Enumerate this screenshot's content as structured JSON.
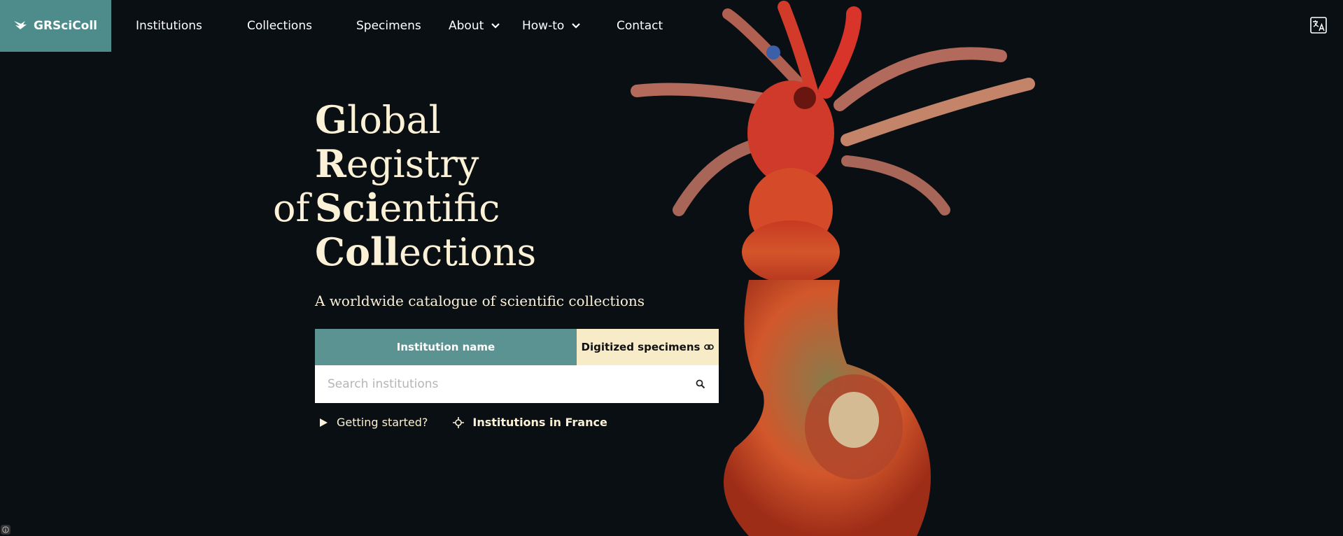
{
  "nav": {
    "brand": "GRSciColl",
    "items": [
      "Institutions",
      "Collections",
      "Specimens",
      "About",
      "How-to",
      "Contact"
    ]
  },
  "hero": {
    "title": [
      {
        "pre": "",
        "bold": "G",
        "rest": "lobal"
      },
      {
        "pre": "",
        "bold": "R",
        "rest": "egistry"
      },
      {
        "pre": "of",
        "bold": "Sci",
        "rest": "entific"
      },
      {
        "pre": "",
        "bold": "Coll",
        "rest": "ections"
      }
    ],
    "subtitle": "A worldwide catalogue of scientific collections"
  },
  "search": {
    "tab_institution": "Institution name",
    "tab_specimens": "Digitized specimens",
    "placeholder": "Search institutions"
  },
  "links": {
    "getting_started": "Getting started?",
    "country": "Institutions in France"
  },
  "colors": {
    "background": "#0a0f14",
    "brand": "#4e8b8b",
    "title": "#fbf1d6",
    "tab_specimens": "#f7ebc8"
  },
  "icons": [
    "bird-logo-icon",
    "chevron-down-icon",
    "translate-icon",
    "link-icon",
    "search-icon",
    "play-icon",
    "crosshair-icon",
    "info-icon"
  ]
}
